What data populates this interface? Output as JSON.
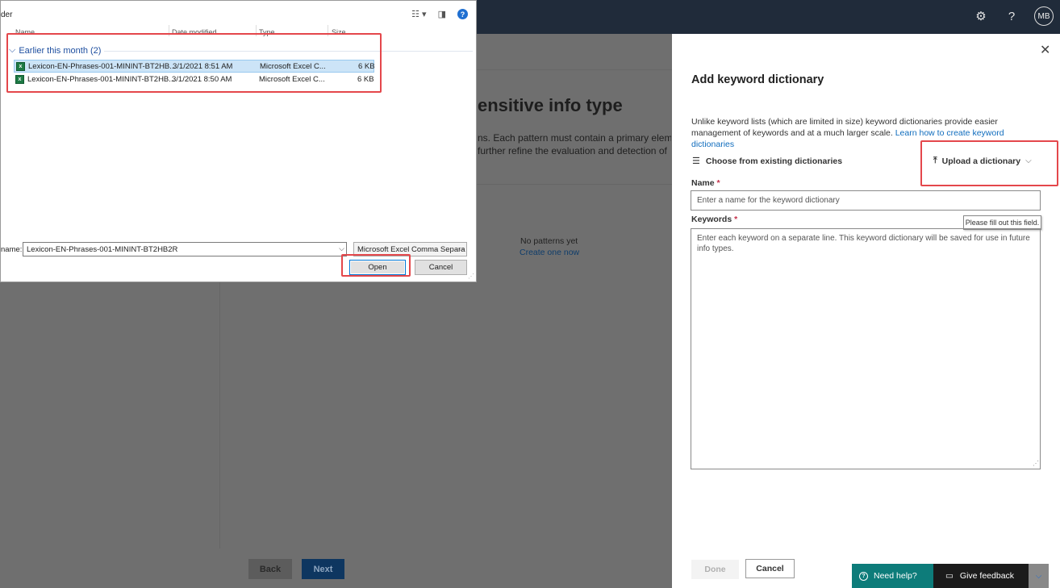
{
  "topbar": {
    "avatar_initials": "MB",
    "settings_icon": "gear-icon",
    "help_icon": "question-icon"
  },
  "background": {
    "page_title": "ensitive info type",
    "description_line1": "ns. Each pattern must contain a primary elem",
    "description_line2": "further refine the evaluation and detection of",
    "no_patterns": "No patterns yet",
    "create_link": "Create one now",
    "back_label": "Back",
    "next_label": "Next"
  },
  "file_dialog": {
    "folder_label": "der",
    "columns": [
      "Name",
      "Date modified",
      "Type",
      "Size"
    ],
    "group_label": "Earlier this month (2)",
    "files": [
      {
        "name": "Lexicon-EN-Phrases-001-MININT-BT2HB...",
        "date": "3/1/2021 8:51 AM",
        "type": "Microsoft Excel C...",
        "size": "6 KB",
        "selected": true
      },
      {
        "name": "Lexicon-EN-Phrases-001-MININT-BT2HB...",
        "date": "3/1/2021 8:50 AM",
        "type": "Microsoft Excel C...",
        "size": "6 KB",
        "selected": false
      }
    ],
    "filename_label": "name:",
    "filename_value": "Lexicon-EN-Phrases-001-MININT-BT2HB2R",
    "filetype_value": "Microsoft Excel Comma Separa",
    "open_label": "Open",
    "cancel_label": "Cancel",
    "highlight_color": "#e4474b"
  },
  "panel": {
    "title": "Add keyword dictionary",
    "description": "Unlike keyword lists (which are limited in size) keyword dictionaries provide easier management of keywords and at a much larger scale. ",
    "learn_link": "Learn how to create keyword dictionaries",
    "choose_label": "Choose from existing dictionaries",
    "upload_label": "Upload a dictionary",
    "name_label": "Name",
    "name_placeholder": "Enter a name for the keyword dictionary",
    "keywords_label": "Keywords",
    "keywords_placeholder": "Enter each keyword on a separate line. This keyword dictionary will be saved for use in future info types.",
    "tooltip": "Please fill out this field.",
    "done_label": "Done",
    "cancel_label": "Cancel"
  },
  "footer": {
    "help_label": "Need help?",
    "feedback_label": "Give feedback",
    "help_color": "#0d7c7a"
  }
}
